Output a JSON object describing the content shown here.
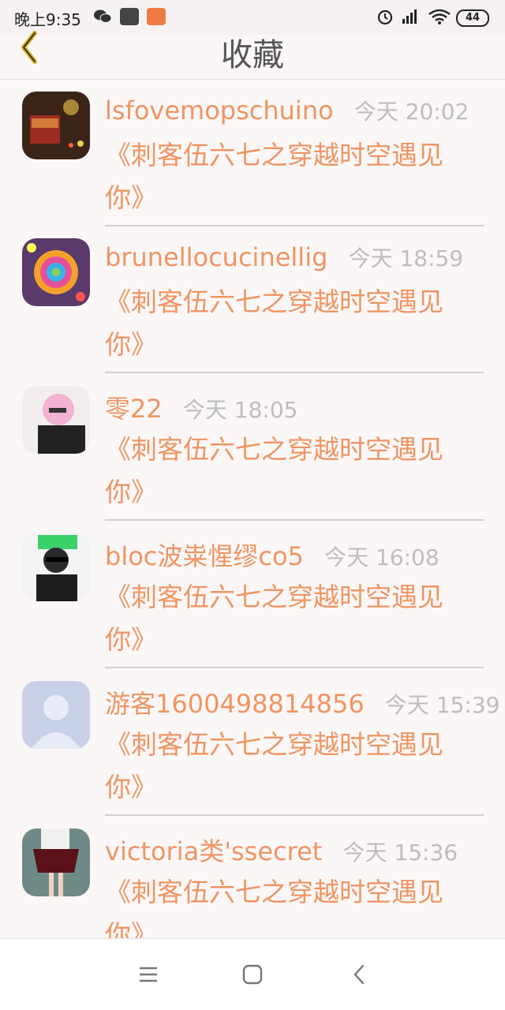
{
  "status_bar": {
    "time": "晚上9:35",
    "battery": "44",
    "icons": [
      "wechat-icon",
      "mi-store-icon",
      "app-icon",
      "alarm-icon",
      "signal-icon",
      "wifi-icon",
      "battery-icon"
    ]
  },
  "header": {
    "title": "收藏",
    "back_icon": "chevron-left-icon"
  },
  "items": [
    {
      "name": "lsfovemopschuino",
      "time": "今天 20:02",
      "content": "《刺客伍六七之穿越时空遇见你》"
    },
    {
      "name": "brunellocucinellig",
      "time": "今天 18:59",
      "content": "《刺客伍六七之穿越时空遇见你》"
    },
    {
      "name": "零22",
      "time": "今天 18:05",
      "content": "《刺客伍六七之穿越时空遇见你》"
    },
    {
      "name": "bloc波粜惺缪co5",
      "time": "今天 16:08",
      "content": "《刺客伍六七之穿越时空遇见你》"
    },
    {
      "name": "游客1600498814856",
      "time": "今天 15:39",
      "content": "《刺客伍六七之穿越时空遇见你》"
    },
    {
      "name": "victoria类'ssecret",
      "time": "今天 15:36",
      "content": "《刺客伍六七之穿越时空遇见你》"
    }
  ],
  "colors": {
    "accent": "#ef9563",
    "time": "#bdbdbd",
    "background": "#fbf7f7"
  },
  "navbar": {
    "icons": [
      "menu-icon",
      "home-square-icon",
      "back-chevron-icon"
    ]
  }
}
